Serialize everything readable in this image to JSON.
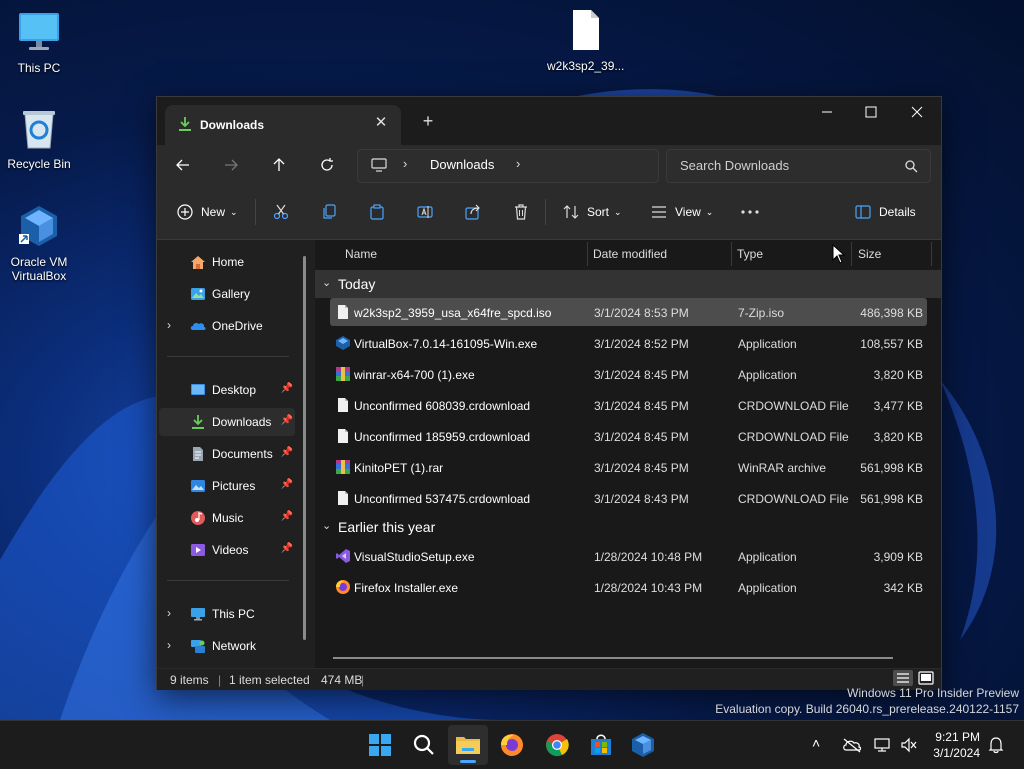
{
  "desktop": {
    "icons": [
      {
        "label": "This PC",
        "icon": "monitor-icon"
      },
      {
        "label": "Recycle Bin",
        "icon": "recycle-bin-icon"
      },
      {
        "label": "Oracle VM VirtualBox",
        "icon": "virtualbox-icon"
      },
      {
        "label": "w2k3sp2_39...",
        "icon": "file-icon"
      }
    ]
  },
  "window": {
    "tab_title": "Downloads",
    "breadcrumb": [
      "Downloads"
    ],
    "search_placeholder": "Search Downloads",
    "toolbar": {
      "new_label": "New",
      "sort_label": "Sort",
      "view_label": "View",
      "details_label": "Details"
    },
    "sidebar": {
      "items": [
        {
          "label": "Home",
          "icon": "home-icon",
          "pinned": false
        },
        {
          "label": "Gallery",
          "icon": "gallery-icon",
          "pinned": false
        },
        {
          "label": "OneDrive",
          "icon": "onedrive-icon",
          "pinned": false,
          "expandable": true
        },
        {
          "label": "Desktop",
          "icon": "desktop-folder-icon",
          "pinned": true
        },
        {
          "label": "Downloads",
          "icon": "downloads-icon",
          "pinned": true,
          "selected": true
        },
        {
          "label": "Documents",
          "icon": "documents-icon",
          "pinned": true
        },
        {
          "label": "Pictures",
          "icon": "pictures-icon",
          "pinned": true
        },
        {
          "label": "Music",
          "icon": "music-icon",
          "pinned": true
        },
        {
          "label": "Videos",
          "icon": "videos-icon",
          "pinned": true
        },
        {
          "label": "This PC",
          "icon": "this-pc-icon",
          "pinned": false,
          "expandable": true
        },
        {
          "label": "Network",
          "icon": "network-icon",
          "pinned": false,
          "expandable": true
        }
      ]
    },
    "columns": {
      "name": "Name",
      "date": "Date modified",
      "type": "Type",
      "size": "Size"
    },
    "groups": [
      {
        "label": "Today",
        "files": [
          {
            "name": "w2k3sp2_3959_usa_x64fre_spcd.iso",
            "date": "3/1/2024 8:53 PM",
            "type": "7-Zip.iso",
            "size": "486,398 KB",
            "selected": true,
            "icon": "iso-file-icon"
          },
          {
            "name": "VirtualBox-7.0.14-161095-Win.exe",
            "date": "3/1/2024 8:52 PM",
            "type": "Application",
            "size": "108,557 KB",
            "icon": "virtualbox-icon"
          },
          {
            "name": "winrar-x64-700 (1).exe",
            "date": "3/1/2024 8:45 PM",
            "type": "Application",
            "size": "3,820 KB",
            "icon": "winrar-icon"
          },
          {
            "name": "Unconfirmed 608039.crdownload",
            "date": "3/1/2024 8:45 PM",
            "type": "CRDOWNLOAD File",
            "size": "3,477 KB",
            "icon": "file-icon"
          },
          {
            "name": "Unconfirmed 185959.crdownload",
            "date": "3/1/2024 8:45 PM",
            "type": "CRDOWNLOAD File",
            "size": "3,820 KB",
            "icon": "file-icon"
          },
          {
            "name": "KinitoPET (1).rar",
            "date": "3/1/2024 8:45 PM",
            "type": "WinRAR archive",
            "size": "561,998 KB",
            "icon": "winrar-icon"
          },
          {
            "name": "Unconfirmed 537475.crdownload",
            "date": "3/1/2024 8:43 PM",
            "type": "CRDOWNLOAD File",
            "size": "561,998 KB",
            "icon": "file-icon"
          }
        ]
      },
      {
        "label": "Earlier this year",
        "files": [
          {
            "name": "VisualStudioSetup.exe",
            "date": "1/28/2024 10:48 PM",
            "type": "Application",
            "size": "3,909 KB",
            "icon": "visual-studio-icon"
          },
          {
            "name": "Firefox Installer.exe",
            "date": "1/28/2024 10:43 PM",
            "type": "Application",
            "size": "342 KB",
            "icon": "firefox-icon"
          }
        ]
      }
    ],
    "status": {
      "items": "9 items",
      "selected": "1 item selected",
      "size": "474 MB"
    }
  },
  "watermark": {
    "line1": "Windows 11 Pro Insider Preview",
    "line2": "Evaluation copy. Build 26040.rs_prerelease.240122-1157"
  },
  "taskbar": {
    "apps": [
      "start-icon",
      "search-icon",
      "file-explorer-icon",
      "firefox-icon",
      "chrome-icon",
      "store-icon",
      "virtualbox-icon"
    ],
    "time": "9:21 PM",
    "date": "3/1/2024"
  },
  "colors": {
    "window_bg": "#202020",
    "selection": "#4d4d4d",
    "accent_green": "#6ccb5f",
    "accent_blue": "#0078d4"
  }
}
